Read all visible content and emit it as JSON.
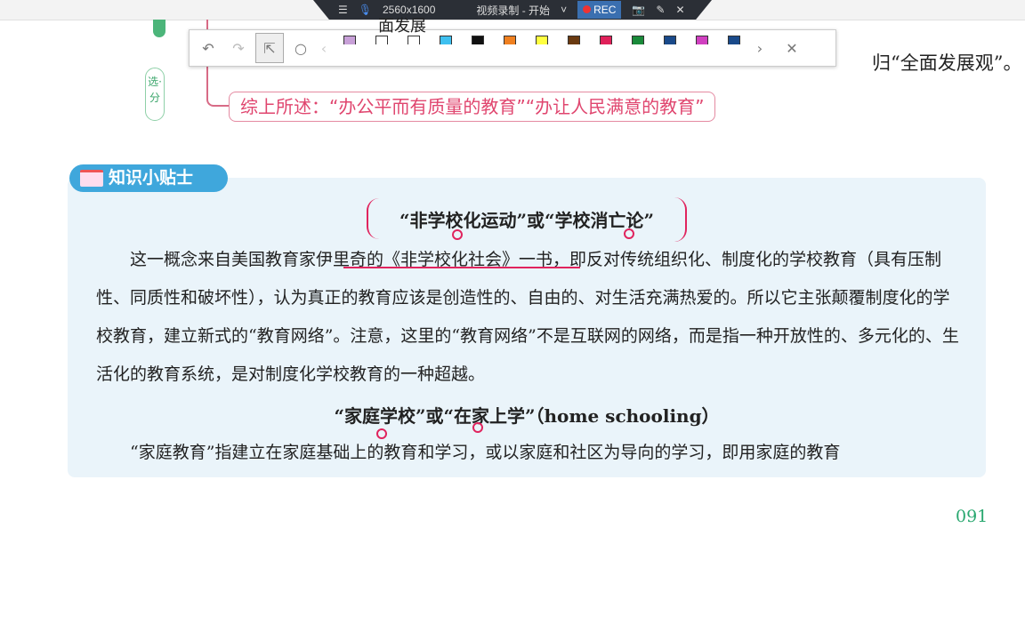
{
  "recorder": {
    "resolution": "2560x1600",
    "title": "视频录制 - 开始",
    "rec": "REC"
  },
  "annotation_toolbar": {
    "pens": [
      "#c8a0d8",
      "#ffffff",
      "#ffffff",
      "#3ec0f0",
      "#111111",
      "#f08020",
      "#ffff40",
      "#6a3a10",
      "#e0205a",
      "#1a8a3a",
      "#1a4a8a",
      "#d040c0",
      "#1a4a8a"
    ]
  },
  "background": {
    "partial_heading": "面发展",
    "partial_tail": "归“全面发展观”。",
    "tag": "选·分"
  },
  "summary": "综上所述：“办公平而有质量的教育”“办让人民满意的教育”",
  "tips": {
    "badge": "知识小贴士",
    "heading1": "“非学校化运动”或“学校消亡论”",
    "para1": "这一概念来自美国教育家伊里奇的《非学校化社会》一书，即反对传统组织化、制度化的学校教育（具有压制性、同质性和破坏性），认为真正的教育应该是创造性的、自由的、对生活充满热爱的。所以它主张颠覆制度化的学校教育，建立新式的“教育网络”。注意，这里的“教育网络”不是互联网的网络，而是指一种开放性的、多元化的、生活化的教育系统，是对制度化学校教育的一种超越。",
    "heading2": "“家庭学校”或“在家上学”（home schooling）",
    "para2": "“家庭教育”指建立在家庭基础上的教育和学习，或以家庭和社区为导向的学习，即用家庭的教育"
  },
  "page_number": "091"
}
